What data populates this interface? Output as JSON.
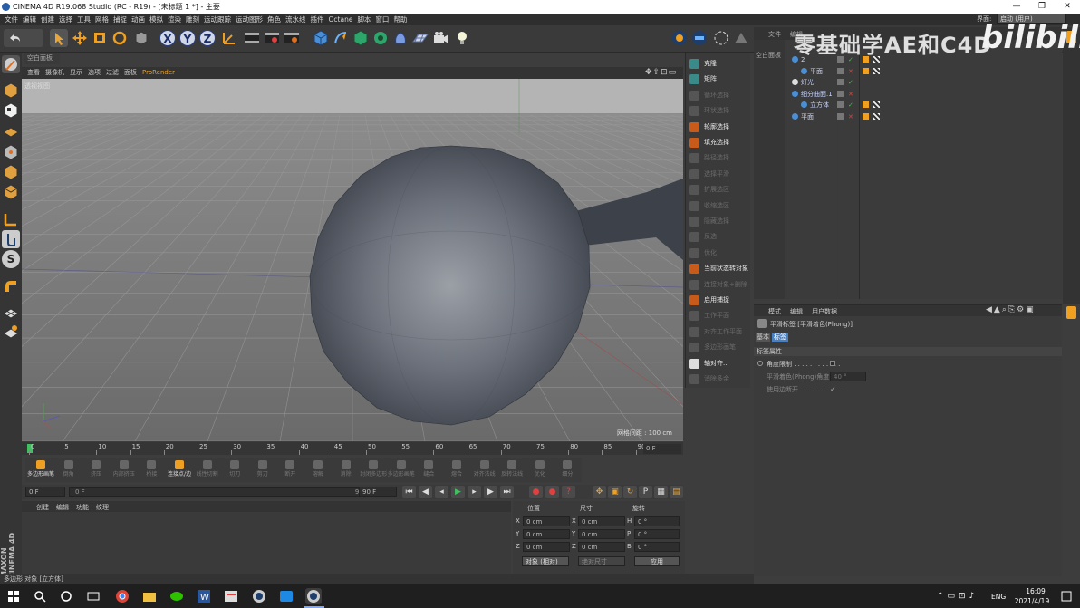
{
  "window": {
    "title": "CINEMA 4D R19.068 Studio (RC - R19) - [未标题 1 *] - 主要"
  },
  "menu": [
    "文件",
    "编辑",
    "创建",
    "选择",
    "工具",
    "网格",
    "捕捉",
    "动画",
    "模拟",
    "渲染",
    "雕刻",
    "运动跟踪",
    "运动图形",
    "角色",
    "流水线",
    "插件",
    "Octane",
    "脚本",
    "窗口",
    "帮助"
  ],
  "layout": {
    "label": "界面:",
    "value": "启动 (用户)"
  },
  "viewport": {
    "tab": "空白面板",
    "menu": [
      "查看",
      "摄像机",
      "显示",
      "选项",
      "过滤",
      "面板",
      "ProRender"
    ],
    "label": "透视视图",
    "grid_info": "网格间距 : 100 cm"
  },
  "select_panel": [
    {
      "label": "克隆",
      "active": true,
      "color": "#3a8a8a"
    },
    {
      "label": "矩阵",
      "active": true,
      "color": "#3a8a8a"
    },
    {
      "label": "循环选择",
      "active": false,
      "color": "#555"
    },
    {
      "label": "环状选择",
      "active": false,
      "color": "#555"
    },
    {
      "label": "轮廓选择",
      "active": true,
      "color": "#c85a1a"
    },
    {
      "label": "填充选择",
      "active": true,
      "color": "#c85a1a"
    },
    {
      "label": "路径选择",
      "active": false,
      "color": "#555"
    },
    {
      "label": "选择平滑",
      "active": false,
      "color": "#555"
    },
    {
      "label": "扩展选区",
      "active": false,
      "color": "#555"
    },
    {
      "label": "收缩选区",
      "active": false,
      "color": "#555"
    },
    {
      "label": "隐藏选择",
      "active": false,
      "color": "#555"
    },
    {
      "label": "反选",
      "active": false,
      "color": "#555"
    },
    {
      "label": "优化",
      "active": false,
      "color": "#555"
    },
    {
      "label": "当前状态转对象",
      "active": true,
      "color": "#c85a1a"
    },
    {
      "label": "连接对象+删除",
      "active": false,
      "color": "#555"
    },
    {
      "label": "启用捕捉",
      "active": true,
      "color": "#c85a1a"
    },
    {
      "label": "工作平面",
      "active": false,
      "color": "#555"
    },
    {
      "label": "对齐工作平面",
      "active": false,
      "color": "#555"
    },
    {
      "label": "多边形画笔",
      "active": false,
      "color": "#555"
    },
    {
      "label": "轴对齐...",
      "active": true,
      "color": "#ddd"
    },
    {
      "label": "消除多余",
      "active": false,
      "color": "#555"
    }
  ],
  "object_manager": {
    "tabs": [
      "文件",
      "编辑"
    ],
    "side": "空白面板",
    "rows": [
      {
        "name": "2",
        "indent": 0
      },
      {
        "name": "平面",
        "indent": 1
      },
      {
        "name": "灯光",
        "indent": 0
      },
      {
        "name": "细分曲面.1",
        "indent": 0
      },
      {
        "name": "立方体",
        "indent": 1
      },
      {
        "name": "平面",
        "indent": 0
      }
    ]
  },
  "attributes": {
    "menu": [
      "模式",
      "编辑",
      "用户数据"
    ],
    "title": "平滑标签 [平滑着色(Phong)]",
    "tabs": [
      "基本",
      "标签"
    ],
    "section": "标签属性",
    "fields": [
      {
        "label": "角度限制 . . . . . . . . . . . .",
        "value": ""
      },
      {
        "label": "平滑着色(Phong)角度",
        "value": "40 °"
      },
      {
        "label": "使用边断开 . . . . . . . . . . .",
        "value": "✓"
      }
    ]
  },
  "timeline": {
    "ticks": [
      "0",
      "5",
      "10",
      "15",
      "20",
      "25",
      "30",
      "35",
      "40",
      "45",
      "50",
      "55",
      "60",
      "65",
      "70",
      "75",
      "80",
      "85",
      "90"
    ],
    "frame_display": "0 F"
  },
  "tools_row": [
    "多边形画笔",
    "倒角",
    "挤压",
    "内部挤压",
    "桥接",
    "连接点/边",
    "线性切割",
    "切刀",
    "剪刀",
    "断开",
    "溶解",
    "消除",
    "封闭多边形孔洞",
    "多边形画笔",
    "缝合",
    "熔合",
    "对齐法线",
    "反转法线",
    "优化",
    "细分"
  ],
  "anim": {
    "start": "0 F",
    "cur": "0 F",
    "end": "90 F",
    "end2": "90 F"
  },
  "material": {
    "menu": [
      "创建",
      "编辑",
      "功能",
      "纹理"
    ]
  },
  "coords": {
    "headers": [
      "位置",
      "尺寸",
      "旋转"
    ],
    "rows": [
      {
        "axis": "X",
        "pos": "0 cm",
        "size": "0 cm",
        "rot_axis": "H",
        "rot": "0 °"
      },
      {
        "axis": "Y",
        "pos": "0 cm",
        "size": "0 cm",
        "rot_axis": "P",
        "rot": "0 °"
      },
      {
        "axis": "Z",
        "pos": "0 cm",
        "size": "0 cm",
        "rot_axis": "B",
        "rot": "0 °"
      }
    ],
    "mode": "对象 (相对)",
    "size_mode": "绝对尺寸",
    "apply": "应用"
  },
  "status": "多边形 对象 [立方体]",
  "brand": "MAXON CINEMA 4D",
  "watermark": "零基础学AE和C4D",
  "bilibili": "bilibili",
  "taskbar": {
    "time": "16:09",
    "date": "2021/4/19",
    "lang": "ENG"
  }
}
